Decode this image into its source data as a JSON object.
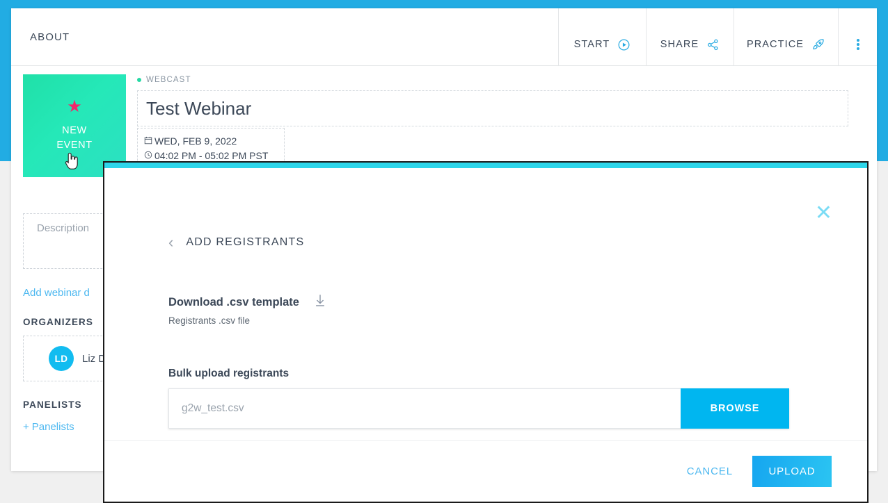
{
  "header": {
    "tab_about": "ABOUT",
    "buttons": [
      {
        "label": "START",
        "icon": "play-circle-icon"
      },
      {
        "label": "SHARE",
        "icon": "share-nodes-icon"
      },
      {
        "label": "PRACTICE",
        "icon": "rocket-icon"
      }
    ],
    "overflow_icon": "kebab-menu-icon"
  },
  "sidebar": {
    "new_event": {
      "line1": "NEW",
      "line2": "EVENT",
      "icon": "star-icon"
    },
    "description_placeholder": "Description",
    "add_webinar_details_link": "Add webinar d",
    "organizers_heading": "ORGANIZERS",
    "organizer": {
      "initials": "LD",
      "name": "Liz D"
    },
    "panelists_heading": "PANELISTS",
    "add_panelists_link": "Panelists",
    "add_panelists_plus": "+"
  },
  "event": {
    "type_label": "WEBCAST",
    "title": "Test Webinar",
    "date": "WED, FEB 9, 2022",
    "time": "04:02 PM - 05:02 PM PST",
    "calendar_icon": "calendar-icon",
    "clock_icon": "clock-icon"
  },
  "modal": {
    "title": "ADD REGISTRANTS",
    "back_icon": "chevron-left-icon",
    "close_icon": "close-icon",
    "download": {
      "title": "Download .csv template",
      "subtitle": "Registrants .csv file",
      "icon": "download-icon"
    },
    "bulk": {
      "label": "Bulk upload registrants",
      "file_placeholder": "g2w_test.csv",
      "file_value": "",
      "browse_label": "BROWSE"
    },
    "footer": {
      "cancel_label": "CANCEL",
      "upload_label": "UPLOAD"
    }
  },
  "colors": {
    "page_blue": "#22ACE3",
    "accent_cyan": "#00B6F0",
    "modal_top_bar": "#2ED6EA",
    "tile_green": "#25E8B8",
    "star_pink": "#F4256A",
    "link_blue": "#4db8f0",
    "avatar_blue": "#12BCF0",
    "webcast_dot_green": "#25D9A4"
  }
}
